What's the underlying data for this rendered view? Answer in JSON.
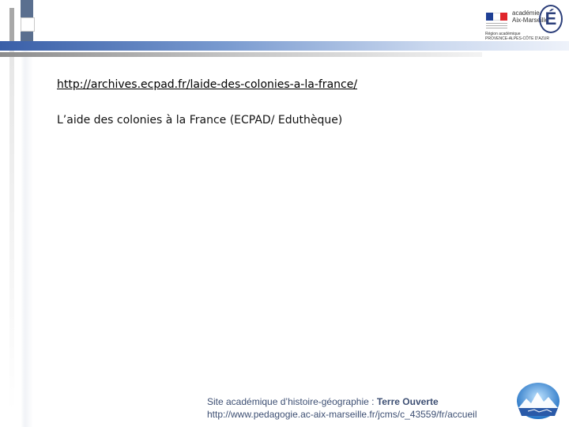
{
  "header": {
    "logo": {
      "name": "academie-aix-marseille-logo",
      "line1": "académie",
      "line2": "Aix-Marseille",
      "letter": "É",
      "region_line1": "Région académique",
      "region_line2": "PROVENCE-ALPES-CÔTE D'AZUR"
    }
  },
  "content": {
    "link_text": "http://archives.ecpad.fr/laide-des-colonies-a-la-france/",
    "description": "L’aide des colonies à la France (ECPAD/ Eduthèque)"
  },
  "footer": {
    "site_prefix": "Site académique d’histoire-géographie : ",
    "site_name": "Terre Ouverte",
    "url": "http://www.pedagogie.ac-aix-marseille.fr/jcms/c_43559/fr/accueil",
    "logo_icon": "earth-globe-icon"
  },
  "colors": {
    "header_bar": "#3a5fa8",
    "footer_text": "#3d4f73",
    "logo_blue": "#2c3f7a"
  }
}
